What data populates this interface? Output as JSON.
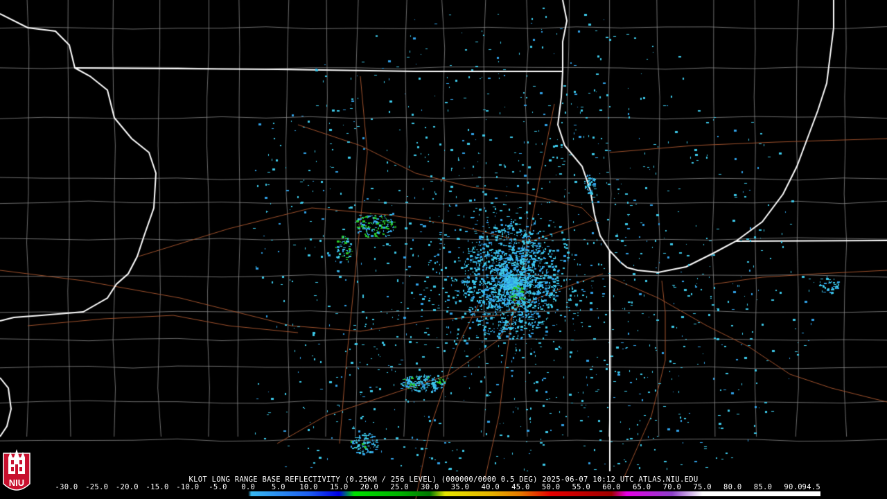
{
  "product": {
    "caption": "KLOT LONG RANGE BASE REFLECTIVITY (0.25KM / 256 LEVEL) (000000/0000 0.5 DEG) 2025-06-07 10:12 UTC  ATLAS.NIU.EDU",
    "radar_site": "KLOT",
    "elevation_deg": 0.5,
    "datetime": "2025-06-07 10:12 UTC"
  },
  "logo": {
    "text": "NIU",
    "icon": "niu-tower-logo",
    "color": "#c8102e"
  },
  "colorbar": {
    "labels": [
      "-30.0",
      "-25.0",
      "-20.0",
      "-15.0",
      "-10.0",
      "-5.0",
      "0.0",
      "5.0",
      "10.0",
      "15.0",
      "20.0",
      "25.0",
      "30.0",
      "35.0",
      "40.0",
      "45.0",
      "50.0",
      "55.0",
      "60.0",
      "65.0",
      "70.0",
      "75.0",
      "80.0",
      "85.0",
      "90.0",
      "94.5"
    ],
    "min": -30.0,
    "max": 94.5,
    "stops": [
      {
        "value": -30.0,
        "color": "#000000"
      },
      {
        "value": 0.0,
        "color": "#000000"
      },
      {
        "value": 0.5,
        "color": "#38b8f0"
      },
      {
        "value": 10.0,
        "color": "#1e5ff0"
      },
      {
        "value": 15.0,
        "color": "#0000e6"
      },
      {
        "value": 17.5,
        "color": "#00e000"
      },
      {
        "value": 25.0,
        "color": "#00b400"
      },
      {
        "value": 30.0,
        "color": "#007800"
      },
      {
        "value": 32.5,
        "color": "#e6e600"
      },
      {
        "value": 40.0,
        "color": "#e6b400"
      },
      {
        "value": 45.0,
        "color": "#e67800"
      },
      {
        "value": 50.0,
        "color": "#e60000"
      },
      {
        "value": 60.0,
        "color": "#a00000"
      },
      {
        "value": 62.5,
        "color": "#e600e6"
      },
      {
        "value": 70.0,
        "color": "#8c40c8"
      },
      {
        "value": 75.0,
        "color": "#ffffff"
      },
      {
        "value": 94.5,
        "color": "#ffffff"
      }
    ]
  },
  "colors": {
    "background": "#000000",
    "state_border": "#ffffff",
    "county_line": "#8a8a8a",
    "highway": "#a0522d",
    "echo_primary": "#3cc8e8",
    "echo_light": "#30a0e6",
    "echo_strong": "#28c828"
  },
  "icons": [
    "niu-tower-logo"
  ]
}
